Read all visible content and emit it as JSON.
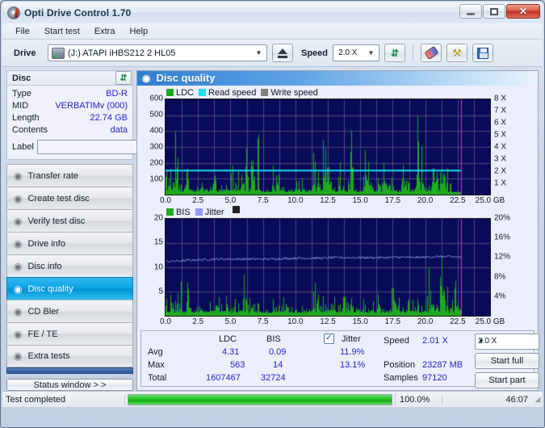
{
  "window": {
    "title": "Opti Drive Control 1.70",
    "icon": "disc-icon",
    "minimize": "minimize-icon",
    "maximize": "maximize-icon",
    "close": "✕"
  },
  "menu": {
    "items": [
      "File",
      "Start test",
      "Extra",
      "Help"
    ]
  },
  "toolbar": {
    "drive_label": "Drive",
    "drive_value": "(J:)   ATAPI iHBS212   2 HL05",
    "eject_icon": "eject-icon",
    "speed_label": "Speed",
    "speed_value": "2.0 X",
    "refresh_icon": "refresh-icon",
    "eraser_icon": "eraser-icon",
    "tools_icon": "wrench-icon",
    "save_icon": "save-icon"
  },
  "disc": {
    "header": "Disc",
    "refresh_icon": "refresh-icon",
    "rows": [
      {
        "key": "Type",
        "value": "BD-R"
      },
      {
        "key": "MID",
        "value": "VERBATIMv (000)"
      },
      {
        "key": "Length",
        "value": "22.74 GB"
      },
      {
        "key": "Contents",
        "value": "data"
      }
    ],
    "label_key": "Label",
    "label_value": "",
    "label_button_icon": "disc-icon"
  },
  "nav": {
    "items": [
      {
        "label": "Transfer rate",
        "icon": "disc-icon",
        "selected": false
      },
      {
        "label": "Create test disc",
        "icon": "disc-icon",
        "selected": false
      },
      {
        "label": "Verify test disc",
        "icon": "disc-icon",
        "selected": false
      },
      {
        "label": "Drive info",
        "icon": "disc-icon",
        "selected": false
      },
      {
        "label": "Disc info",
        "icon": "disc-icon",
        "selected": false
      },
      {
        "label": "Disc quality",
        "icon": "disc-icon",
        "selected": true
      },
      {
        "label": "CD Bler",
        "icon": "disc-icon",
        "selected": false
      },
      {
        "label": "FE / TE",
        "icon": "disc-icon",
        "selected": false
      },
      {
        "label": "Extra tests",
        "icon": "disc-icon",
        "selected": false
      }
    ],
    "status_window_button": "Status window > >"
  },
  "panel": {
    "title": "Disc quality",
    "icon": "disc-icon"
  },
  "stats": {
    "col_ldc": "LDC",
    "col_bis": "BIS",
    "jitter_label": "Jitter",
    "jitter_checked": "✓",
    "rows": [
      {
        "name": "Avg",
        "ldc": "4.31",
        "bis": "0.09",
        "jitter": "11.9%"
      },
      {
        "name": "Max",
        "ldc": "563",
        "bis": "14",
        "jitter": "13.1%"
      },
      {
        "name": "Total",
        "ldc": "1607467",
        "bis": "32724",
        "jitter": ""
      }
    ],
    "speed_key": "Speed",
    "speed_value": "2.01 X",
    "position_key": "Position",
    "position_value": "23287 MB",
    "samples_key": "Samples",
    "samples_value": "97120",
    "speed_select": "2.0 X",
    "start_full": "Start full",
    "start_part": "Start part"
  },
  "statusbar": {
    "message": "Test completed",
    "percent_text": "100.0%",
    "progress": 100,
    "elapsed": "46:07"
  },
  "colors": {
    "ldc_green": "#1faa1f",
    "read_speed_cyan": "#14e0f0",
    "write_speed_gray": "#808080",
    "bis_green": "#1faa1f",
    "jitter_lavender": "#9b9bf0",
    "plot_bg": "#0a0a5a",
    "marker_magenta": "#d43cd4",
    "accent_blue": "#2222cc"
  },
  "chart_data": [
    {
      "type": "area",
      "id": "quality-chart",
      "title": "",
      "xlabel": "GB",
      "ylabel": "LDC",
      "xlim": [
        0,
        25
      ],
      "ylim": [
        0,
        600
      ],
      "y2lim": [
        0,
        8
      ],
      "y2label": "X",
      "grid": true,
      "legend": [
        "LDC",
        "Read speed",
        "Write speed"
      ],
      "legend_position": "top-left",
      "xticks": [
        "0.0",
        "2.5",
        "5.0",
        "7.5",
        "10.0",
        "12.5",
        "15.0",
        "17.5",
        "20.0",
        "22.5",
        "25.0 GB"
      ],
      "yticks": [
        100,
        200,
        300,
        400,
        500,
        600
      ],
      "y2ticks": [
        "1 X",
        "2 X",
        "3 X",
        "4 X",
        "5 X",
        "6 X",
        "7 X",
        "8 X"
      ],
      "data_end_gb": 22.74,
      "read_speed_const": 2.01,
      "series": [
        {
          "name": "LDC",
          "color": "#1faa1f",
          "x": [
            0.0,
            0.1,
            0.2,
            0.3,
            0.4,
            0.5,
            0.6,
            0.7,
            0.8,
            0.9,
            1.0,
            1.1,
            1.2,
            1.3,
            1.4,
            1.5,
            1.6,
            1.7,
            1.8,
            1.9,
            2.0,
            2.1,
            2.2,
            2.3,
            2.4,
            2.5,
            2.6,
            2.7,
            2.8,
            2.9,
            3.0,
            3.1,
            3.2,
            3.3,
            3.4,
            3.5,
            3.6,
            3.7,
            3.8,
            3.9,
            4.0,
            4.1,
            4.2,
            4.3,
            4.4,
            4.5,
            4.6,
            4.7,
            4.8,
            4.9,
            5.0,
            5.1,
            5.2,
            5.3,
            5.4,
            5.5,
            5.6,
            5.7,
            5.8,
            5.9,
            6.0,
            6.1,
            6.2,
            6.3,
            6.4,
            6.5,
            6.6,
            6.7,
            6.8,
            6.9,
            7.0,
            7.1,
            7.2,
            7.3,
            7.4,
            7.5,
            7.6,
            7.7,
            7.8,
            7.9,
            8.0,
            8.2,
            8.4,
            8.6,
            8.8,
            9.0,
            9.2,
            9.4,
            9.6,
            9.8,
            10.0,
            10.2,
            10.4,
            10.6,
            10.8,
            11.0,
            11.2,
            11.4,
            11.6,
            11.8,
            12.0,
            12.2,
            12.4,
            12.6,
            12.8,
            13.0,
            13.2,
            13.4,
            13.6,
            13.8,
            14.0,
            14.2,
            14.4,
            14.6,
            14.8,
            15.0,
            15.2,
            15.4,
            15.6,
            15.8,
            16.0,
            16.2,
            16.4,
            16.6,
            16.8,
            17.0,
            17.2,
            17.4,
            17.6,
            17.8,
            18.0,
            18.2,
            18.4,
            18.6,
            18.8,
            19.0,
            19.2,
            19.4,
            19.6,
            19.8,
            20.0,
            20.2,
            20.4,
            20.6,
            20.8,
            21.0,
            21.2,
            21.4,
            21.6,
            21.8,
            22.0,
            22.2,
            22.4,
            22.6,
            22.74
          ],
          "values": [
            280,
            60,
            90,
            495,
            150,
            130,
            200,
            310,
            530,
            380,
            395,
            100,
            60,
            70,
            150,
            200,
            443,
            120,
            60,
            40,
            55,
            60,
            45,
            50,
            70,
            90,
            60,
            45,
            310,
            100,
            55,
            60,
            443,
            80,
            90,
            60,
            130,
            408,
            300,
            70,
            45,
            60,
            90,
            55,
            40,
            45,
            60,
            55,
            45,
            35,
            40,
            300,
            90,
            60,
            180,
            470,
            200,
            120,
            160,
            300,
            80,
            55,
            290,
            240,
            110,
            60,
            420,
            180,
            360,
            45,
            55,
            405,
            300,
            80,
            60,
            50,
            45,
            60,
            55,
            40,
            30,
            200,
            115,
            330,
            55,
            45,
            40,
            50,
            60,
            45,
            55,
            180,
            120,
            90,
            60,
            45,
            50,
            275,
            120,
            300,
            60,
            450,
            300,
            280,
            60,
            50,
            45,
            210,
            110,
            55,
            60,
            440,
            300,
            140,
            60,
            45,
            50,
            410,
            300,
            250,
            60,
            55,
            185,
            170,
            455,
            290,
            210,
            100,
            60,
            45,
            50,
            370,
            300,
            80,
            60,
            50,
            45,
            490,
            420,
            290,
            120,
            60,
            45,
            560,
            330,
            240,
            120,
            270,
            310,
            50,
            370
          ]
        },
        {
          "name": "Read speed",
          "color": "#14e0f0",
          "constant": 2.01
        },
        {
          "name": "Write speed",
          "color": "#808080",
          "values": []
        }
      ]
    },
    {
      "type": "area",
      "id": "bis-jitter-chart",
      "title": "",
      "xlabel": "GB",
      "ylabel": "BIS",
      "xlim": [
        0,
        25
      ],
      "ylim": [
        0,
        20
      ],
      "y2lim": [
        0,
        20
      ],
      "y2label": "%",
      "grid": true,
      "legend": [
        "BIS",
        "Jitter"
      ],
      "legend_position": "top-left",
      "xticks": [
        "0.0",
        "2.5",
        "5.0",
        "7.5",
        "10.0",
        "12.5",
        "15.0",
        "17.5",
        "20.0",
        "22.5",
        "25.0 GB"
      ],
      "yticks": [
        5,
        10,
        15,
        20
      ],
      "y2ticks": [
        "4%",
        "8%",
        "12%",
        "16%",
        "20%"
      ],
      "data_end_gb": 22.74,
      "series": [
        {
          "name": "BIS",
          "color": "#1faa1f",
          "x": [
            0.0,
            0.15,
            0.3,
            0.45,
            0.6,
            0.75,
            0.9,
            1.05,
            1.2,
            1.35,
            1.5,
            1.65,
            1.8,
            1.95,
            2.1,
            2.25,
            2.4,
            2.55,
            2.7,
            2.85,
            3.0,
            3.15,
            3.3,
            3.45,
            3.6,
            3.75,
            3.9,
            4.05,
            4.2,
            4.35,
            4.5,
            4.65,
            4.8,
            4.95,
            5.1,
            5.25,
            5.4,
            5.55,
            5.7,
            5.85,
            6.0,
            6.15,
            6.3,
            6.45,
            6.6,
            6.75,
            6.9,
            7.05,
            7.2,
            7.35,
            7.5,
            7.65,
            7.8,
            7.95,
            8.1,
            8.4,
            8.7,
            9.0,
            9.3,
            9.6,
            9.9,
            10.2,
            10.5,
            10.8,
            11.1,
            11.4,
            11.7,
            12.0,
            12.3,
            12.6,
            12.9,
            13.2,
            13.5,
            13.8,
            14.1,
            14.4,
            14.7,
            15.0,
            15.3,
            15.6,
            15.9,
            16.2,
            16.5,
            16.8,
            17.1,
            17.4,
            17.7,
            18.0,
            18.3,
            18.6,
            18.9,
            19.2,
            19.5,
            19.8,
            20.1,
            20.4,
            20.7,
            21.0,
            21.3,
            21.6,
            21.9,
            22.2,
            22.5,
            22.74
          ],
          "values": [
            5,
            1,
            2,
            11,
            4,
            3,
            7,
            10,
            7,
            3,
            2,
            9,
            3,
            2,
            1,
            2,
            3,
            2,
            5,
            4,
            2,
            1,
            9,
            4,
            3,
            2,
            5,
            9,
            3,
            2,
            1,
            4,
            3,
            2,
            1,
            2,
            7,
            3,
            5,
            2,
            9,
            4,
            2,
            8,
            3,
            2,
            7,
            3,
            2,
            1,
            2,
            3,
            2,
            1,
            2,
            4,
            3,
            2,
            7,
            3,
            2,
            1,
            2,
            3,
            2,
            5,
            9,
            4,
            3,
            2,
            5,
            3,
            2,
            9,
            4,
            3,
            6,
            5,
            3,
            2,
            4,
            7,
            6,
            3,
            2,
            5,
            11,
            6,
            3,
            2,
            5,
            4,
            3,
            2,
            8,
            10,
            6,
            4,
            14,
            7,
            5,
            6,
            7,
            5
          ]
        },
        {
          "name": "Jitter",
          "color": "#9b9bf0",
          "x": [
            0.0,
            1.0,
            2.0,
            3.0,
            4.0,
            5.0,
            6.0,
            7.0,
            8.0,
            9.0,
            10.0,
            11.0,
            12.0,
            13.0,
            14.0,
            15.0,
            16.0,
            17.0,
            18.0,
            19.0,
            20.0,
            21.0,
            22.0,
            22.74
          ],
          "values": [
            11.2,
            11.3,
            11.5,
            11.6,
            11.7,
            11.7,
            11.7,
            11.7,
            11.7,
            11.8,
            11.9,
            11.9,
            11.9,
            12.0,
            12.0,
            12.0,
            12.0,
            12.0,
            12.1,
            12.0,
            12.1,
            12.2,
            12.2,
            12.1
          ]
        }
      ]
    }
  ]
}
